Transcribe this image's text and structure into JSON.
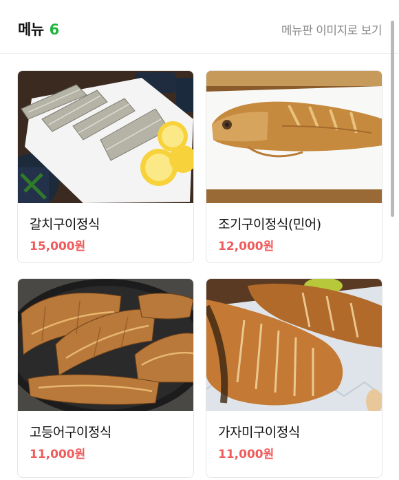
{
  "header": {
    "title": "메뉴",
    "count": "6",
    "menu_image_link": "메뉴판 이미지로 보기"
  },
  "menu_items": [
    {
      "name": "갈치구이정식",
      "price": "15,000원"
    },
    {
      "name": "조기구이정식(민어)",
      "price": "12,000원"
    },
    {
      "name": "고등어구이정식",
      "price": "11,000원"
    },
    {
      "name": "가자미구이정식",
      "price": "11,000원"
    }
  ],
  "colors": {
    "accent_green": "#1fb53b",
    "price_red": "#ef5b5b"
  }
}
